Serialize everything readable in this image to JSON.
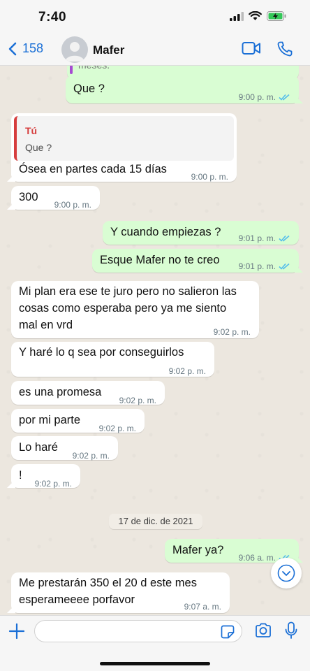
{
  "status_bar": {
    "time": "7:40"
  },
  "header": {
    "back_count": "158",
    "contact_name": "Mafer"
  },
  "quoted_partial": "meses.",
  "messages": [
    {
      "dir": "out",
      "text": "Que ?",
      "time": "9:00 p. m."
    },
    {
      "dir": "in",
      "reply_author": "Tú",
      "reply_text": "Que ?",
      "text": "Ósea en partes cada 15 días",
      "time": "9:00 p. m."
    },
    {
      "dir": "in",
      "text": "300",
      "time": "9:00 p. m."
    },
    {
      "dir": "out",
      "text": "Y cuando empiezas ?",
      "time": "9:01 p. m."
    },
    {
      "dir": "out",
      "text": "Esque Mafer no te creo",
      "time": "9:01 p. m."
    },
    {
      "dir": "in",
      "lines": [
        "Mi plan era ese te juro pero no salieron las",
        "cosas como esperaba pero ya me siento",
        "mal en vrd"
      ],
      "time": "9:02 p. m."
    },
    {
      "dir": "in",
      "text": "Y haré lo q sea por conseguirlos",
      "time": "9:02 p. m."
    },
    {
      "dir": "in",
      "text": "es una promesa",
      "time": "9:02 p. m."
    },
    {
      "dir": "in",
      "text": "por mi parte",
      "time": "9:02 p. m."
    },
    {
      "dir": "in",
      "text": "Lo haré",
      "time": "9:02 p. m."
    },
    {
      "dir": "in",
      "text": "!",
      "time": "9:02 p. m."
    },
    {
      "dir": "out",
      "text": "Mafer ya?",
      "time": "9:06 a. m."
    },
    {
      "dir": "in",
      "lines": [
        "Me prestarán 350 el 20 d este mes",
        "esperameeee porfavor"
      ],
      "time": "9:07 a. m."
    }
  ],
  "date_separator": "17 de dic. de 2021",
  "input": {
    "placeholder": ""
  },
  "colors": {
    "accent": "#1a6fd6",
    "outgoing_bubble": "#d9fdd3",
    "read_ticks": "#53bdeb",
    "reply_bar": "#d63d3d"
  }
}
